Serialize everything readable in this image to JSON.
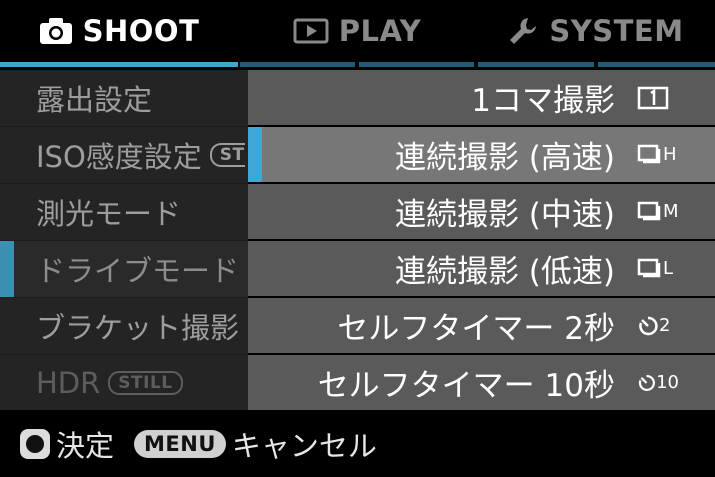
{
  "tabs": [
    {
      "label": "SHOOT",
      "icon": "camera-icon",
      "active": true
    },
    {
      "label": "PLAY",
      "icon": "play-icon",
      "active": false
    },
    {
      "label": "SYSTEM",
      "icon": "wrench-icon",
      "active": false
    }
  ],
  "left_menu": [
    {
      "label": "露出設定"
    },
    {
      "label": "ISO感度設定",
      "badge": "ST"
    },
    {
      "label": "測光モード"
    },
    {
      "label": "ドライブモード"
    },
    {
      "label": "ブラケット撮影"
    },
    {
      "label": "HDR",
      "badge": "STILL"
    }
  ],
  "options": [
    {
      "label": "1コマ撮影",
      "icon": "single-frame-icon"
    },
    {
      "label": "連続撮影 (高速)",
      "icon": "continuous-high-icon",
      "icon_suffix": "H"
    },
    {
      "label": "連続撮影 (中速)",
      "icon": "continuous-medium-icon",
      "icon_suffix": "M"
    },
    {
      "label": "連続撮影 (低速)",
      "icon": "continuous-low-icon",
      "icon_suffix": "L"
    },
    {
      "label": "セルフタイマー 2秒",
      "icon": "self-timer-2s-icon",
      "icon_suffix": "2"
    },
    {
      "label": "セルフタイマー 10秒",
      "icon": "self-timer-10s-icon",
      "icon_suffix": "10"
    }
  ],
  "footer": {
    "ok_label": "決定",
    "menu_key": "MENU",
    "cancel_label": "キャンセル"
  },
  "colors": {
    "accent": "#3fa7d6",
    "selected_row": "#777777",
    "option_row": "#5a5a5a",
    "menu_row": "#242424"
  }
}
